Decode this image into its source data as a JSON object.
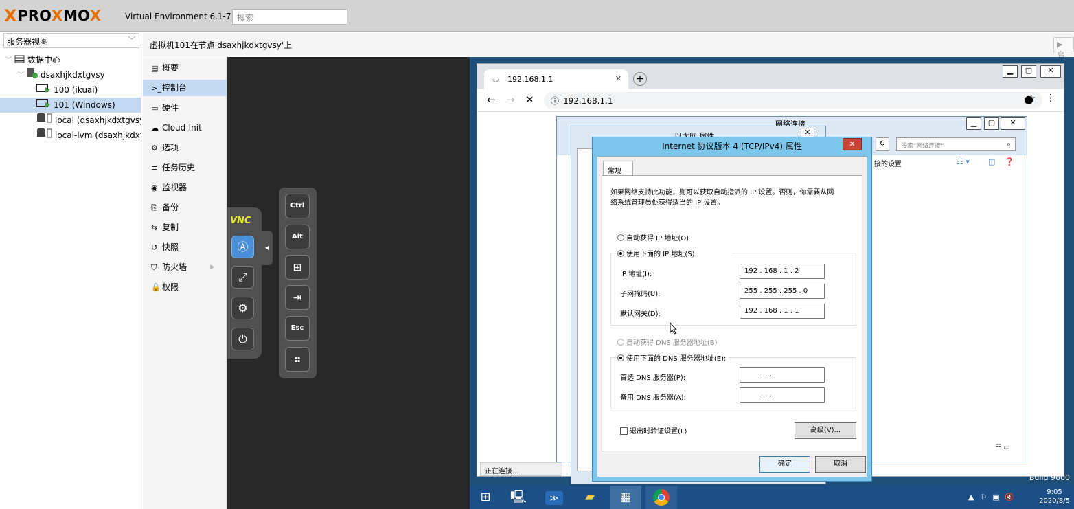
{
  "topbar": {
    "logo_x": "X",
    "logo_pro": "PRO",
    "logo_x2": "X",
    "logo_mo": "MO",
    "logo_x3": "X",
    "version": "Virtual Environment 6.1-7",
    "search_placeholder": "搜索"
  },
  "tree": {
    "view_label": "服务器视图",
    "items": [
      {
        "label": "数据中心"
      },
      {
        "label": "dsaxhjkdxtgvsy"
      },
      {
        "label": "100 (ikuai)"
      },
      {
        "label": "101 (Windows)"
      },
      {
        "label": "local (dsaxhjkdxtgvsy)"
      },
      {
        "label": "local-lvm (dsaxhjkdxtgvsy)"
      }
    ]
  },
  "header": {
    "title": "虚拟机101在节点'dsaxhjkdxtgvsy'上",
    "start_label": "▶ 启"
  },
  "menu": {
    "items": [
      {
        "icon": "▤",
        "label": "概要"
      },
      {
        "icon": ">_",
        "label": "控制台"
      },
      {
        "icon": "▭",
        "label": "硬件"
      },
      {
        "icon": "☁",
        "label": "Cloud-Init"
      },
      {
        "icon": "⚙",
        "label": "选项"
      },
      {
        "icon": "≡",
        "label": "任务历史"
      },
      {
        "icon": "◉",
        "label": "监视器"
      },
      {
        "icon": "⎘",
        "label": "备份"
      },
      {
        "icon": "⇆",
        "label": "复制"
      },
      {
        "icon": "↺",
        "label": "快照"
      },
      {
        "icon": "⛉",
        "label": "防火墙"
      },
      {
        "icon": "🔓",
        "label": "权限"
      }
    ]
  },
  "novnc": {
    "logo": "VNC",
    "keys": [
      "Ctrl",
      "Alt",
      "⊞",
      "⇥",
      "Esc",
      "⠶"
    ]
  },
  "browser": {
    "tab_title": "192.168.1.1",
    "address": "192.168.1.1",
    "status": "正在连接..."
  },
  "netconn": {
    "title": "网络连接",
    "search_placeholder": "搜索\"网络连接\"",
    "toolbar_text": "接的设置"
  },
  "ethernet": {
    "title": "以太网 属性"
  },
  "ipv4": {
    "title": "Internet 协议版本 4 (TCP/IPv4) 属性",
    "tab": "常规",
    "desc_line1": "如果网络支持此功能，则可以获取自动指派的 IP 设置。否则，你需要从网",
    "desc_line2": "络系统管理员处获得适当的 IP 设置。",
    "auto_ip": "自动获得 IP 地址(O)",
    "manual_ip": "使用下面的 IP 地址(S):",
    "ip_label": "IP 地址(I):",
    "ip_value": "192 . 168 .  1  .  2",
    "mask_label": "子网掩码(U):",
    "mask_value": "255 . 255 . 255 .  0",
    "gw_label": "默认网关(D):",
    "gw_value": "192 . 168 .  1  .  1",
    "auto_dns": "自动获得 DNS 服务器地址(B)",
    "manual_dns": "使用下面的 DNS 服务器地址(E):",
    "dns1_label": "首选 DNS 服务器(P):",
    "dns1_value": ".      .      .",
    "dns2_label": "备用 DNS 服务器(A):",
    "dns2_value": ".      .      .",
    "validate": "退出时验证设置(L)",
    "advanced": "高级(V)...",
    "ok": "确定",
    "cancel": "取消"
  },
  "taskbar": {
    "time": "9:05",
    "date": "2020/8/5",
    "build": "Build 9600"
  }
}
